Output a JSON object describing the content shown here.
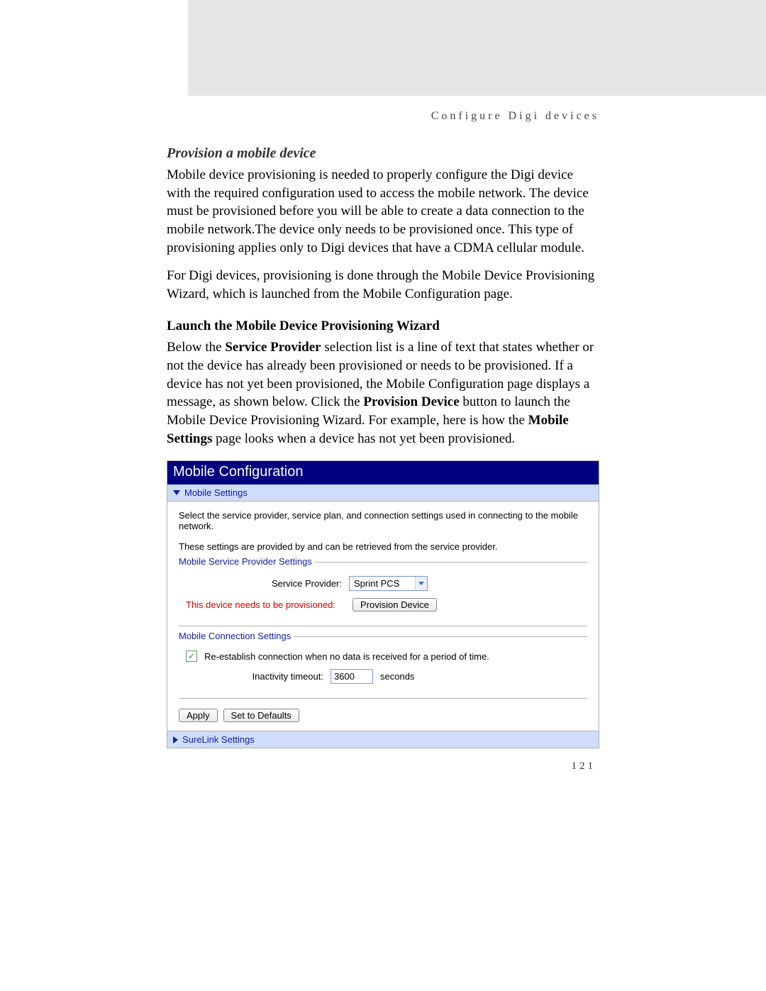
{
  "running_head": "Configure Digi devices",
  "section_title": "Provision a mobile device",
  "para1": "Mobile device provisioning is needed to properly configure the Digi device with the required configuration used to access the mobile network. The device must be provisioned before you will be able to create a data connection to the mobile network.The device only needs to be provisioned once. This type of provisioning applies only to Digi devices that have a CDMA cellular module.",
  "para2": "For Digi devices, provisioning is done through the Mobile Device Provisioning Wizard, which is launched from the Mobile Configuration page.",
  "subheading": "Launch the Mobile Device Provisioning Wizard",
  "para3_parts": {
    "a": "Below the ",
    "b_bold": "Service Provider",
    "c": " selection list is a line of text that states whether or not the device has already been provisioned or needs to be provisioned. If a device has not yet been provisioned, the Mobile Configuration page displays a message, as shown below. Click the ",
    "d_bold": "Provision Device",
    "e": " button to launch the Mobile Device Provisioning Wizard. For example, here is how the ",
    "f_bold": "Mobile Settings",
    "g": " page looks when a device has not yet been provisioned."
  },
  "ui": {
    "title": "Mobile Configuration",
    "section_mobile_settings": "Mobile Settings",
    "intro1": "Select the service provider, service plan, and connection settings used in connecting to the mobile network.",
    "intro2": "These settings are provided by and can be retrieved from the service provider.",
    "fieldset1": "Mobile Service Provider Settings",
    "service_provider_label": "Service Provider:",
    "service_provider_value": "Sprint PCS",
    "provision_warning": "This device needs to be provisioned:",
    "provision_button": "Provision Device",
    "fieldset2": "Mobile Connection Settings",
    "reestablish_label": "Re-establish connection when no data is received for a period of time.",
    "inactivity_label": "Inactivity timeout:",
    "inactivity_value": "3600",
    "seconds": "seconds",
    "apply": "Apply",
    "defaults": "Set to Defaults",
    "section_surelink": "SureLink Settings"
  },
  "page_number": "121"
}
